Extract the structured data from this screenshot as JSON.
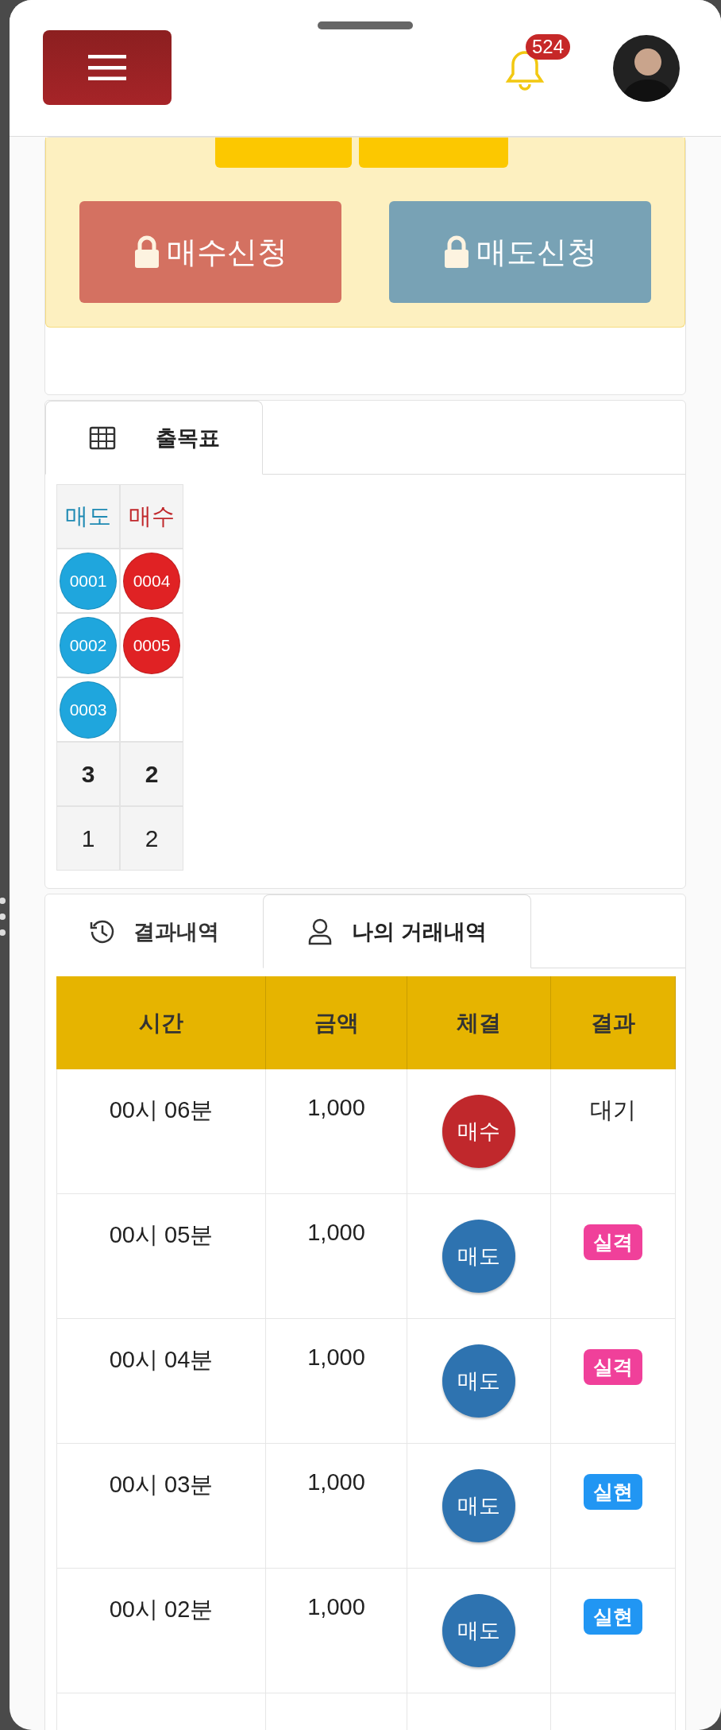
{
  "header": {
    "notification_count": "524"
  },
  "trade_panel": {
    "cut_buttons": [
      {
        "kind": "button"
      },
      {
        "kind": "button"
      }
    ],
    "buttons": [
      {
        "label": "매수신청",
        "kind": "buy",
        "locked": true
      },
      {
        "label": "매도신청",
        "kind": "sell",
        "locked": true
      }
    ]
  },
  "board_card": {
    "tabs": [
      {
        "label": "출목표",
        "kind": "grid",
        "selected": true
      }
    ],
    "columns": [
      {
        "label": "매도",
        "kind": "sell",
        "balls": [
          "0001",
          "0002",
          "0003"
        ],
        "total": "3",
        "column_footer": "1"
      },
      {
        "label": "매수",
        "kind": "buy",
        "balls": [
          "0004",
          "0005"
        ],
        "total": "2",
        "column_footer": "2"
      }
    ]
  },
  "history_card": {
    "tabs": [
      {
        "label": "결과내역",
        "kind": "history",
        "selected": false
      },
      {
        "label": "나의 거래내역",
        "kind": "user",
        "selected": true
      }
    ],
    "table": {
      "columns": [
        "시간",
        "금액",
        "체결",
        "결과"
      ],
      "rows": [
        {
          "time": "00시 06분",
          "amount": "1,000",
          "side": {
            "label": "매수",
            "kind": "buy"
          },
          "result": {
            "label": "대기",
            "kind": "pending"
          }
        },
        {
          "time": "00시 05분",
          "amount": "1,000",
          "side": {
            "label": "매도",
            "kind": "sell"
          },
          "result": {
            "label": "실격",
            "kind": "fail"
          }
        },
        {
          "time": "00시 04분",
          "amount": "1,000",
          "side": {
            "label": "매도",
            "kind": "sell"
          },
          "result": {
            "label": "실격",
            "kind": "fail"
          }
        },
        {
          "time": "00시 03분",
          "amount": "1,000",
          "side": {
            "label": "매도",
            "kind": "sell"
          },
          "result": {
            "label": "실현",
            "kind": "success"
          }
        },
        {
          "time": "00시 02분",
          "amount": "1,000",
          "side": {
            "label": "매도",
            "kind": "sell"
          },
          "result": {
            "label": "실현",
            "kind": "success"
          }
        }
      ]
    }
  }
}
